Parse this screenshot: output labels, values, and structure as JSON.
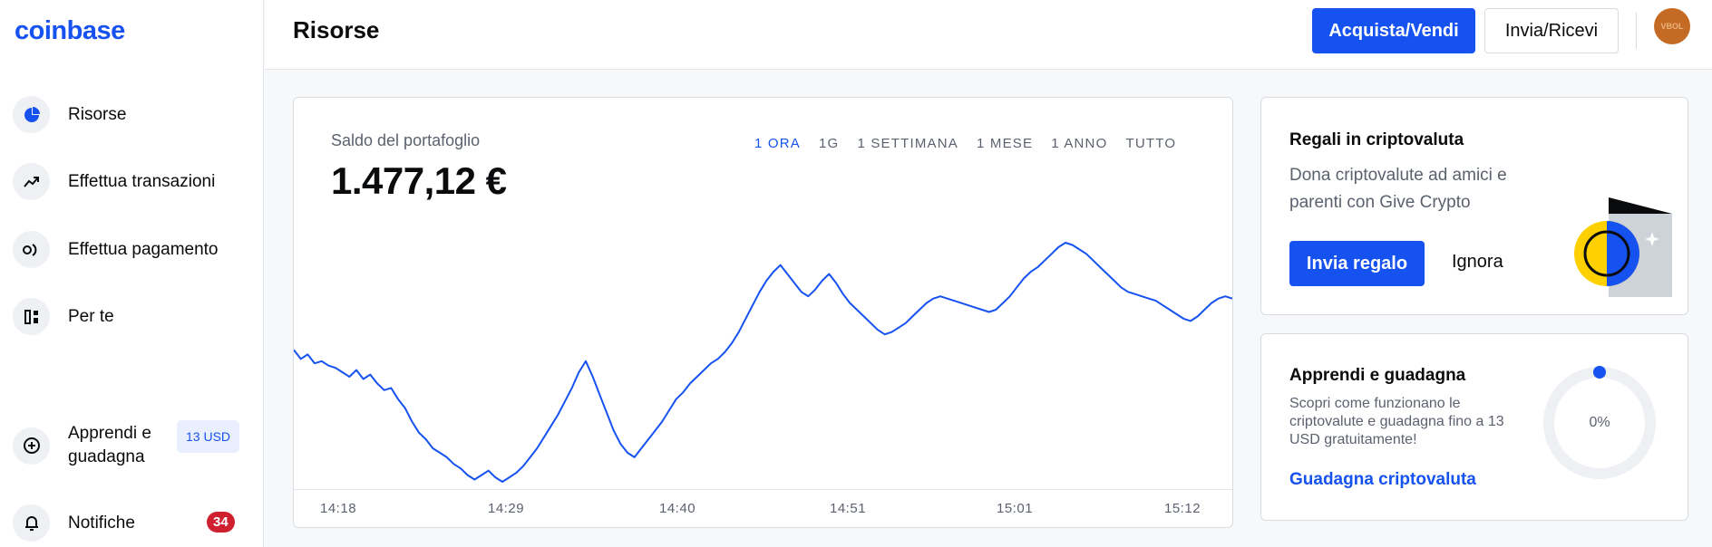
{
  "sidebar": {
    "logo": "coinbase",
    "items": [
      {
        "label": "Risorse",
        "icon": "pie-chart-icon"
      },
      {
        "label": "Effettua transazioni",
        "icon": "trending-up-icon"
      },
      {
        "label": "Effettua pagamento",
        "icon": "payment-icon"
      },
      {
        "label": "Per te",
        "icon": "grid-icon"
      },
      {
        "label": "Apprendi e guadagna",
        "icon": "plus-circle-icon",
        "chip": "13 USD"
      },
      {
        "label": "Notifiche",
        "icon": "bell-icon",
        "badge": "34"
      }
    ]
  },
  "header": {
    "title": "Risorse",
    "buy_sell_label": "Acquista/Vendi",
    "send_receive_label": "Invia/Ricevi",
    "avatar_text": "VBOL"
  },
  "portfolio": {
    "label": "Saldo del portafoglio",
    "value": "1.477,12 €",
    "ranges": [
      "1 ORA",
      "1G",
      "1 SETTIMANA",
      "1 MESE",
      "1 ANNO",
      "TUTTO"
    ],
    "active_range": "1 ORA",
    "x_ticks": [
      "14:18",
      "14:29",
      "14:40",
      "14:51",
      "15:01",
      "15:12"
    ]
  },
  "gift_card": {
    "title": "Regali in criptovaluta",
    "description": "Dona criptovalute ad amici e parenti con Give Crypto",
    "send_button": "Invia regalo",
    "ignore_button": "Ignora"
  },
  "learn_card": {
    "title": "Apprendi e guadagna",
    "description": "Scopri come funzionano le criptovalute e guadagna fino a 13 USD gratuitamente!",
    "link": "Guadagna criptovaluta",
    "progress": "0%"
  },
  "colors": {
    "accent": "#1652f0",
    "badge": "#cf202f",
    "line": "#1652f0"
  },
  "chart_data": {
    "type": "line",
    "x": [
      "14:18",
      "14:29",
      "14:40",
      "14:51",
      "15:01",
      "15:12"
    ],
    "series": [
      {
        "values": [
          0.62,
          0.58,
          0.6,
          0.56,
          0.57,
          0.55,
          0.54,
          0.52,
          0.5,
          0.53,
          0.49,
          0.51,
          0.47,
          0.44,
          0.45,
          0.4,
          0.36,
          0.3,
          0.25,
          0.22,
          0.18,
          0.16,
          0.14,
          0.11,
          0.09,
          0.06,
          0.04,
          0.06,
          0.08,
          0.05,
          0.03,
          0.05,
          0.07,
          0.1,
          0.14,
          0.18,
          0.23,
          0.28,
          0.33,
          0.39,
          0.45,
          0.52,
          0.57,
          0.5,
          0.42,
          0.34,
          0.26,
          0.2,
          0.16,
          0.14,
          0.18,
          0.22,
          0.26,
          0.3,
          0.35,
          0.4,
          0.43,
          0.47,
          0.5,
          0.53,
          0.56,
          0.58,
          0.61,
          0.65,
          0.7,
          0.76,
          0.82,
          0.88,
          0.93,
          0.97,
          1.0,
          0.96,
          0.92,
          0.88,
          0.86,
          0.89,
          0.93,
          0.96,
          0.92,
          0.87,
          0.83,
          0.8,
          0.77,
          0.74,
          0.71,
          0.69,
          0.7,
          0.72,
          0.74,
          0.77,
          0.8,
          0.83,
          0.85,
          0.86,
          0.85,
          0.84,
          0.83,
          0.82,
          0.81,
          0.8,
          0.79,
          0.8,
          0.83,
          0.86,
          0.9,
          0.94,
          0.97,
          0.99,
          1.02,
          1.05,
          1.08,
          1.1,
          1.09,
          1.07,
          1.05,
          1.02,
          0.99,
          0.96,
          0.93,
          0.9,
          0.88,
          0.87,
          0.86,
          0.85,
          0.84,
          0.82,
          0.8,
          0.78,
          0.76,
          0.75,
          0.77,
          0.8,
          0.83,
          0.85,
          0.86,
          0.85
        ]
      }
    ],
    "title": "",
    "xlabel": "",
    "ylabel": ""
  }
}
